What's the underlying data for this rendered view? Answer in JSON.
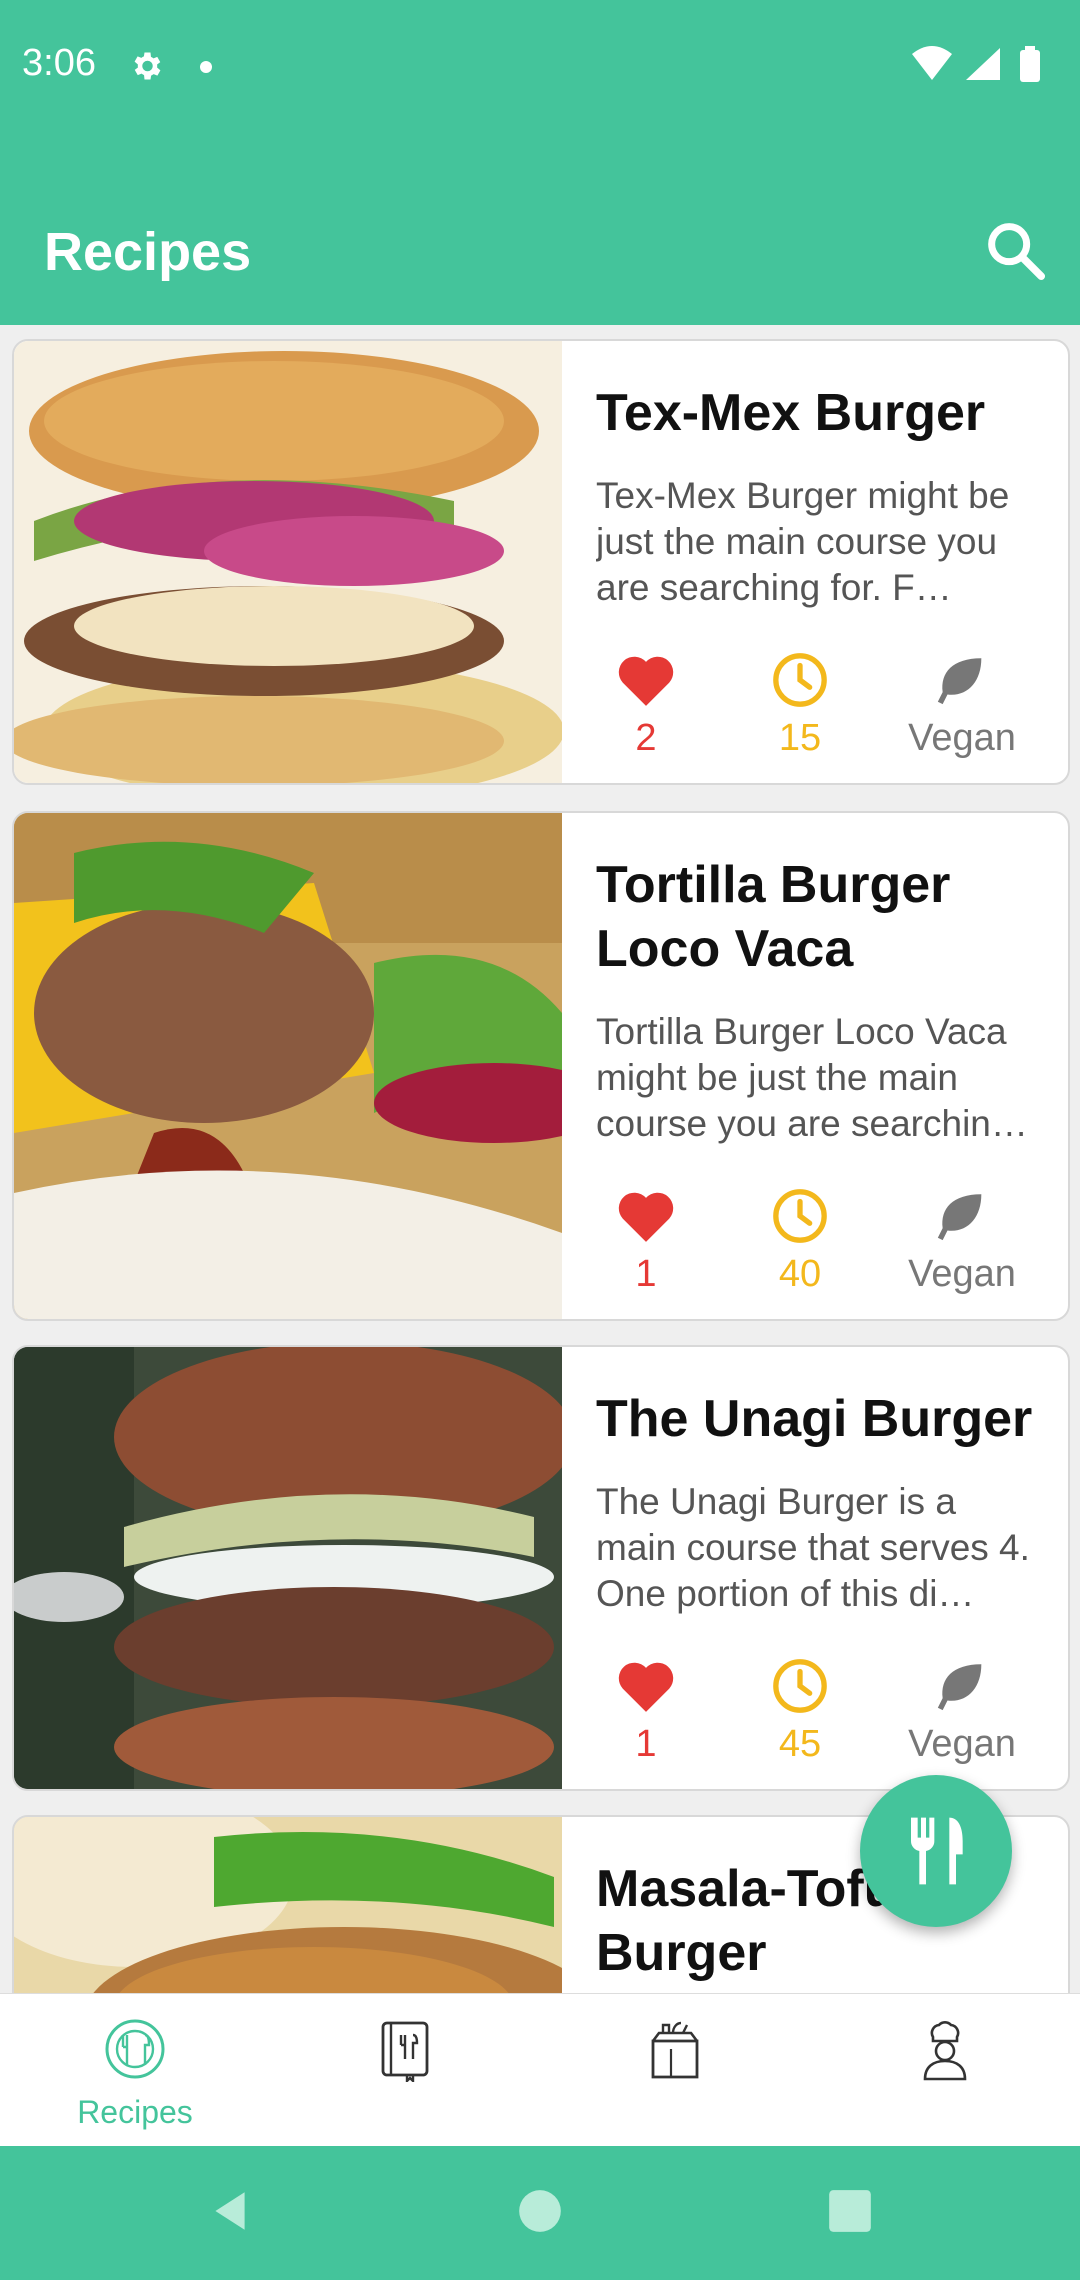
{
  "status_bar": {
    "time": "3:06"
  },
  "app_bar": {
    "title": "Recipes"
  },
  "recipes": [
    {
      "title": "Tex-Mex Burger",
      "description": "Tex-Mex Burger might be just the main course you are searching for. F…",
      "likes": "2",
      "minutes": "15",
      "diet": "Vegan"
    },
    {
      "title": "Tortilla Burger Loco Vaca",
      "description": "Tortilla Burger Loco Vaca might be just the main course you are searchin…",
      "likes": "1",
      "minutes": "40",
      "diet": "Vegan"
    },
    {
      "title": "The Unagi Burger",
      "description": "The Unagi Burger is a main course that serves 4. One portion of this di…",
      "likes": "1",
      "minutes": "45",
      "diet": "Vegan"
    },
    {
      "title": "Masala-Tofu Burger",
      "description": "",
      "likes": "",
      "minutes": "",
      "diet": ""
    }
  ],
  "bottom_nav": {
    "items": [
      {
        "label": "Recipes",
        "icon": "recipes-icon",
        "selected": true
      },
      {
        "label": "",
        "icon": "favorite-recipes-icon",
        "selected": false
      },
      {
        "label": "",
        "icon": "grocery-bag-icon",
        "selected": false
      },
      {
        "label": "",
        "icon": "chef-icon",
        "selected": false
      }
    ]
  },
  "colors": {
    "accent": "#44c49b",
    "like": "#e53935",
    "time": "#f3b81c",
    "vegan": "#777777"
  }
}
